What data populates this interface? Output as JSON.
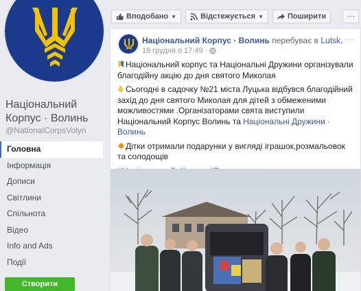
{
  "page": {
    "name": "Національний Корпус · Волинь",
    "handle": "@NationalCorpsVolyn"
  },
  "nav": {
    "items": [
      "Головна",
      "Інформація",
      "Дописи",
      "Світлини",
      "Спільнота",
      "Відео",
      "Info and Ads",
      "Події"
    ],
    "active": "Головна"
  },
  "create_page_button": "Створити сторінку",
  "actions": {
    "like": "Вподобано",
    "follow": "Відстежується",
    "share": "Поширити",
    "more": "···"
  },
  "post": {
    "author": "Національний Корпус · Волинь",
    "location_prefix": "перебуває в",
    "location": "Lutsk",
    "timestamp": "19 грудня о 17:49 ·",
    "menu": "···",
    "paragraph1": "Національний корпус та Національні Дружини організували благодійну акцію до дня святого Миколая",
    "paragraph2_a": "Сьогодні в садочку №21 міста Луцька відбувся благодійний захід до дня святого Миколая для дітей з обмеженими можливостями .Організаторами свята виступили Національний Корпус Волинь та ",
    "paragraph2_link": "Національні Дружини · Волинь",
    "paragraph3": "Дітки отримали подарунки у вигляді іграшок,розмальовок та солодощів",
    "hashtags": [
      "#Національний_Корпус",
      "#Волинь"
    ]
  },
  "icons": {
    "profile": "trident-emblem",
    "like": "thumbs-up-icon",
    "follow": "rss-icon",
    "share": "share-arrow-icon",
    "globe": "globe-icon"
  },
  "colors": {
    "brand_blue": "#4267b2",
    "link": "#365899",
    "emblem_blue": "#1b3a8c",
    "emblem_yellow": "#f5c200",
    "create_green": "#42b72a"
  }
}
